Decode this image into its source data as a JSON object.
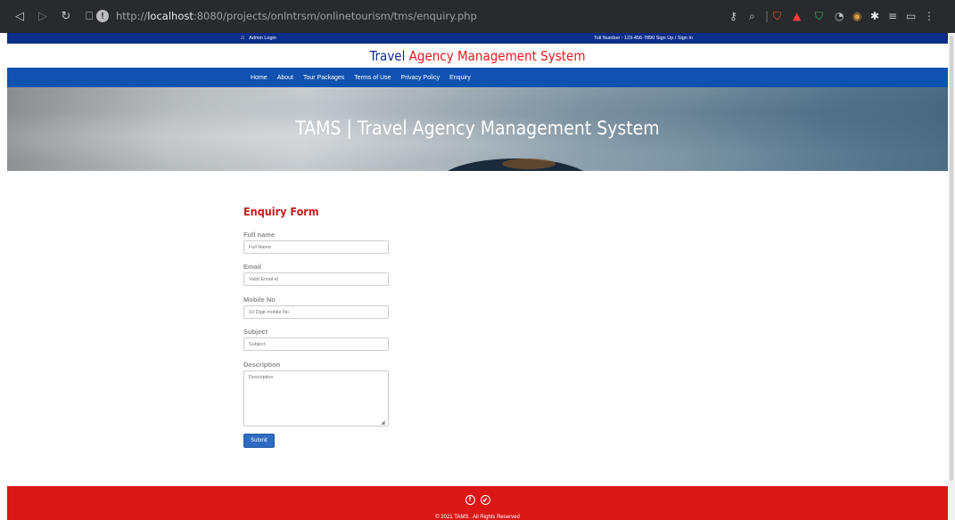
{
  "browser": {
    "url_scheme_host_prefix": "http://",
    "url_host": "localhost",
    "url_rest": ":8080/projects/onlntrsm/onlinetourism/tms/enquiry.php"
  },
  "topbar": {
    "admin_login": "Admin Login",
    "right_text": "Toll Number : 123-456-7890   Sign Up / Sign In"
  },
  "header": {
    "title_part1": "Travel",
    "title_part2": " Agency Management System"
  },
  "nav": {
    "items": [
      "Home",
      "About",
      "Tour Packages",
      "Terms of Use",
      "Privacy Policy",
      "Enquiry"
    ]
  },
  "banner": {
    "title": "TAMS | Travel Agency Management System"
  },
  "form": {
    "title": "Enquiry Form",
    "fullname_label": "Full name",
    "fullname_placeholder": "Full Name",
    "email_label": "Email",
    "email_placeholder": "Valid Email id",
    "mobile_label": "Mobile No",
    "mobile_placeholder": "10 Digit mobile No",
    "subject_label": "Subject",
    "subject_placeholder": "Subject",
    "description_label": "Description",
    "description_placeholder": "Description",
    "submit_label": "Submit"
  },
  "footer": {
    "copyright": "© 2021 TAMS . All Rights Reserved"
  },
  "icons": {
    "home": "home-icon",
    "facebook": "facebook-icon",
    "twitter": "twitter-icon"
  },
  "colors": {
    "topbar": "#0c2d8a",
    "nav": "#1052b0",
    "accent_red": "#e01b1b",
    "footer": "#dc1717",
    "submit": "#2f6bc0"
  }
}
